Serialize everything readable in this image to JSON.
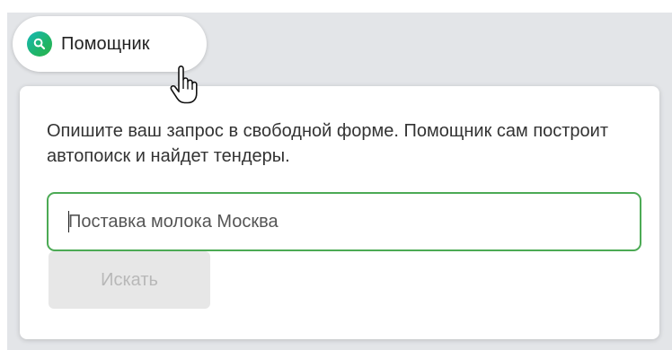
{
  "assistant": {
    "label": "Помощник",
    "icon": "search-icon",
    "icon_gradient": [
      "#17b8b8",
      "#2bb34a"
    ]
  },
  "popup": {
    "description": "Опишите ваш запрос в свободной форме. Помощник сам построит автопоиск и найдет тендеры.",
    "input": {
      "value": "",
      "placeholder": "Поставка молока Москва",
      "border_color": "#4caa55"
    },
    "search_button_label": "Искать"
  },
  "cursor": {
    "icon": "hand-pointer-icon"
  }
}
